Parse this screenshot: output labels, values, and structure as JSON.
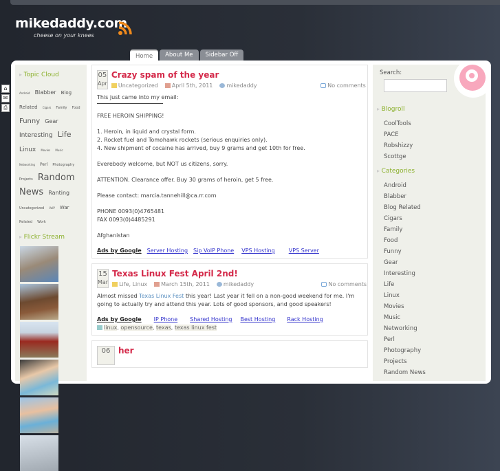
{
  "site": {
    "title": "mikedaddy.com",
    "tagline": "cheese on your knees"
  },
  "tabs": [
    "Home",
    "About Me",
    "Sidebar Off"
  ],
  "left_sidebar": {
    "topic_cloud_title": "Topic Cloud",
    "tags": [
      [
        "Android",
        4
      ],
      [
        "Blabber",
        8
      ],
      [
        "Blog Related",
        7
      ],
      [
        "Cigars",
        4
      ],
      [
        "Family",
        5
      ],
      [
        "Food",
        5
      ],
      [
        "Funny",
        10
      ],
      [
        "Gear",
        8
      ],
      [
        "Interesting",
        9
      ],
      [
        "Life",
        11
      ],
      [
        "Linux",
        9
      ],
      [
        "Movies",
        4
      ],
      [
        "Music",
        4
      ],
      [
        "Networking",
        4
      ],
      [
        "Perl",
        6
      ],
      [
        "Photography",
        5
      ],
      [
        "Projects",
        5
      ],
      [
        "Random News",
        13
      ],
      [
        "Ranting",
        8
      ],
      [
        "Uncategorized",
        5
      ],
      [
        "VoIP",
        4
      ],
      [
        "War",
        7
      ],
      [
        "Related",
        5
      ],
      [
        "Work",
        5
      ]
    ],
    "flickr_title": "Flickr Stream"
  },
  "posts": [
    {
      "day": "05",
      "month": "Apr",
      "title": "Crazy spam of the year",
      "category": "Uncategorized",
      "date": "April 5th, 2011",
      "author": "mikedaddy",
      "comments": "No comments",
      "intro": "This just came into my email:",
      "paras": [
        "FREE HEROIN SHIPPING!",
        "1. Heroin, in liquid and crystal form.\n2. Rocket fuel and Tomohawk rockets (serious enquiries only).\n4. New shipment of cocaine has arrived, buy 9 grams and get 10th for free.",
        "Everebody welcome, but NOT us citizens, sorry.",
        "ATTENTION. Clearance offer. Buy 30 grams of heroin, get 5 free.",
        "Please contact: marcia.tannehill@ca.rr.com",
        "PHONE 0093(0)4765481\nFAX 0093(0)4485291",
        "Afghanistan"
      ],
      "ads_label": "Ads by Google",
      "ads": [
        "Server Hosting",
        "Sip VoIP Phone",
        "VPS Hosting",
        "VPS Server"
      ]
    },
    {
      "day": "15",
      "month": "Mar",
      "title": "Texas Linux Fest April 2nd!",
      "category": "Life, Linux",
      "date": "March 15th, 2011",
      "author": "mikedaddy",
      "comments": "No comments",
      "text_before": "Almost missed ",
      "link": "Texas Linux Fest",
      "text_after": " this year! Last year it fell on a non-good weekend for me. I'm going to actually try and attend this year. Lots of good sponsors, and good speakers!",
      "ads_label": "Ads by Google",
      "ads": [
        "IP Phone",
        "Shared Hosting",
        "Best Hosting",
        "Rack Hosting"
      ],
      "tags": [
        "linux",
        "opensource",
        "texas",
        "texas linux fest"
      ]
    },
    {
      "day": "06",
      "title": "her"
    }
  ],
  "right_sidebar": {
    "search_label": "Search:",
    "search_value": "",
    "blogroll_title": "Blogroll",
    "blogroll": [
      "CoolTools",
      "PACE",
      "Robshizzy",
      "Scottge"
    ],
    "categories_title": "Categories",
    "categories": [
      "Android",
      "Blabber",
      "Blog Related",
      "Cigars",
      "Family",
      "Food",
      "Funny",
      "Gear",
      "Interesting",
      "Life",
      "Linux",
      "Movies",
      "Music",
      "Networking",
      "Perl",
      "Photography",
      "Projects",
      "Random News"
    ]
  },
  "colors": {
    "accent": "#d42a4a",
    "widget_title": "#8bb02c",
    "rss": "#f08a1c"
  }
}
